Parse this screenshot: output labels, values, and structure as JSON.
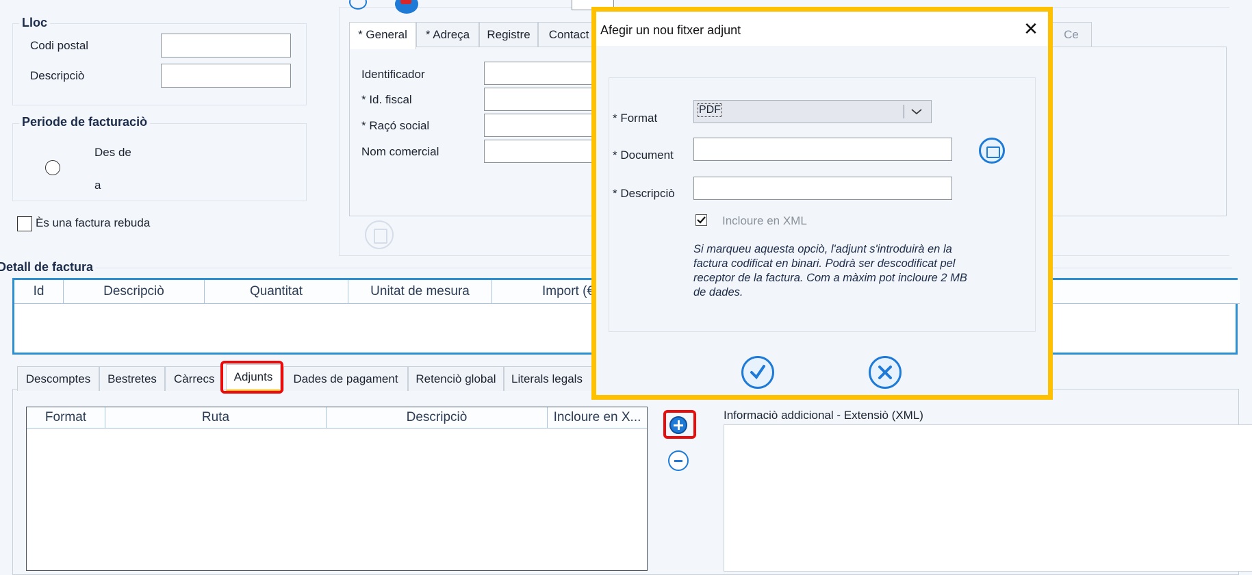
{
  "lloc": {
    "title": "Lloc",
    "codi_postal_label": "Codi postal",
    "descripcio_label": "Descripciò"
  },
  "periode": {
    "title": "Periode de facturaciò",
    "des_de_label": "Des de",
    "a_label": "a"
  },
  "factura_rebuda_label": "Ès una factura rebuda",
  "entity_tabs": [
    "* General",
    "* Adreça",
    "Registre",
    "Contact",
    "Ce"
  ],
  "general": {
    "identificador_label": "Identificador",
    "id_fiscal_label": "* Id. fiscal",
    "raco_social_label": "* Raçó social",
    "nom_comercial_label": "Nom comercial"
  },
  "detall": {
    "title": "Detall de factura",
    "columns": [
      "Id",
      "Descripciò",
      "Quantitat",
      "Unitat de mesura",
      "Import (€"
    ]
  },
  "bottom_tabs": [
    "Descomptes",
    "Bestretes",
    "Càrrecs",
    "Adjunts",
    "Dades de pagament",
    "Retenciò global",
    "Literals legals"
  ],
  "adjunts_table": {
    "columns": [
      "Format",
      "Ruta",
      "Descripciò",
      "Incloure en X..."
    ]
  },
  "info_addicional_label": "Informaciò addicional - Extensiò (XML)",
  "dialog": {
    "title": "Afegir un nou fitxer adjunt",
    "close_symbol": "✕",
    "format_label": "* Format",
    "format_value": "PDF",
    "document_label": "* Document",
    "document_value": "",
    "descripcio_label": "* Descripciò",
    "descripcio_value": "",
    "incloure_label": "Incloure en XML",
    "incloure_checked": true,
    "help_text": "Si marqueu aquesta opciò, l'adjunt s'introduirà en la factura codificat en binari. Podrà ser descodificat pel receptor de la factura. Com a màxim pot incloure 2 MB de dades."
  },
  "colors": {
    "dialog_border": "#ffc000",
    "highlight": "#ea0b0b",
    "grid_border": "#2e8fd0",
    "icon_blue": "#1d7ad6"
  },
  "icons": [
    "folder-icon",
    "confirm-check-icon",
    "cancel-x-icon",
    "add-icon",
    "remove-icon",
    "save-icon"
  ]
}
